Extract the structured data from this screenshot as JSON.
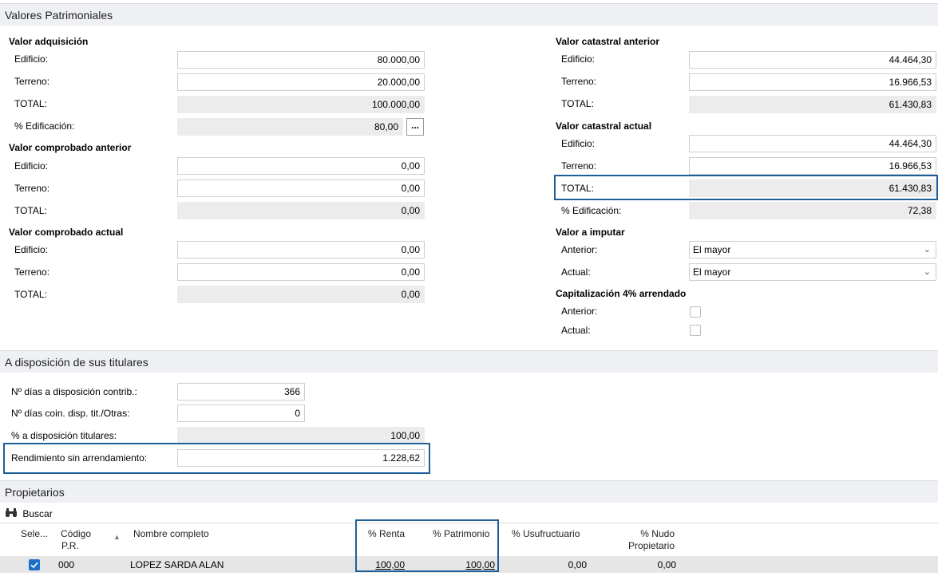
{
  "valores": {
    "header": "Valores Patrimoniales",
    "adquisicion": {
      "title": "Valor adquisición",
      "edificio_label": "Edificio:",
      "edificio": "80.000,00",
      "terreno_label": "Terreno:",
      "terreno": "20.000,00",
      "total_label": "TOTAL:",
      "total": "100.000,00",
      "pct_label": "% Edificación:",
      "pct": "80,00",
      "dots": "..."
    },
    "comp_anterior": {
      "title": "Valor comprobado anterior",
      "edificio_label": "Edificio:",
      "edificio": "0,00",
      "terreno_label": "Terreno:",
      "terreno": "0,00",
      "total_label": "TOTAL:",
      "total": "0,00"
    },
    "comp_actual": {
      "title": "Valor comprobado actual",
      "edificio_label": "Edificio:",
      "edificio": "0,00",
      "terreno_label": "Terreno:",
      "terreno": "0,00",
      "total_label": "TOTAL:",
      "total": "0,00"
    },
    "cat_anterior": {
      "title": "Valor catastral anterior",
      "edificio_label": "Edificio:",
      "edificio": "44.464,30",
      "terreno_label": "Terreno:",
      "terreno": "16.966,53",
      "total_label": "TOTAL:",
      "total": "61.430,83"
    },
    "cat_actual": {
      "title": "Valor catastral actual",
      "edificio_label": "Edificio:",
      "edificio": "44.464,30",
      "terreno_label": "Terreno:",
      "terreno": "16.966,53",
      "total_label": "TOTAL:",
      "total": "61.430,83",
      "pct_label": "% Edificación:",
      "pct": "72,38"
    },
    "imputar": {
      "title": "Valor a imputar",
      "anterior_label": "Anterior:",
      "anterior": "El mayor",
      "actual_label": "Actual:",
      "actual": "El mayor"
    },
    "capitalizacion": {
      "title": "Capitalización 4% arrendado",
      "anterior_label": "Anterior:",
      "actual_label": "Actual:"
    }
  },
  "disposicion": {
    "header": "A disposición de sus titulares",
    "dias_contrib_label": "Nº días a disposición contrib.:",
    "dias_contrib": "366",
    "dias_coin_label": "Nº días coin. disp. tit./Otras:",
    "dias_coin": "0",
    "pct_label": "% a disposición titulares:",
    "pct": "100,00",
    "rend_label": "Rendimiento sin arrendamiento:",
    "rend": "1.228,62"
  },
  "propietarios": {
    "header": "Propietarios",
    "search_label": "Buscar",
    "columns": {
      "sele": "Sele...",
      "codigo_1": "Código",
      "codigo_2": "P.R.",
      "nombre": "Nombre completo",
      "renta": "% Renta",
      "patrimonio": "% Patrimonio",
      "usufructuario": "% Usufructuario",
      "nudo_1": "% Nudo",
      "nudo_2": "Propietario"
    },
    "rows": [
      {
        "codigo": "000",
        "nombre": "LOPEZ SARDA ALAN",
        "renta": "100,00",
        "patrimonio": "100,00",
        "usufructuario": "0,00",
        "nudo": "0,00"
      }
    ]
  },
  "colors": {
    "highlight": "#1f5f99",
    "checkbox": "#1f6fc6",
    "header_bg": "#eef0f3"
  }
}
